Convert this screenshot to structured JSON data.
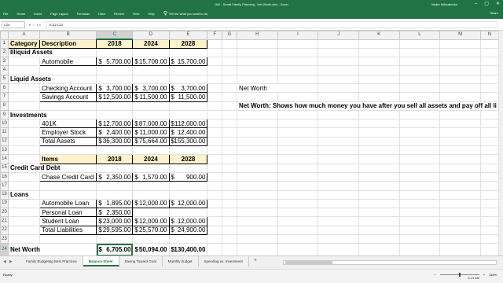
{
  "window": {
    "title": "000 - Smart Family Planning - Net Worth.xlsx - Excel",
    "user": "Vadim Mikhailenko",
    "controls": [
      "–",
      "▢",
      "✕"
    ]
  },
  "ribbon": {
    "tabs": [
      "File",
      "Home",
      "Insert",
      "Page Layout",
      "Formulas",
      "Data",
      "Review",
      "View",
      "Help"
    ],
    "tell_me": "Tell me what you want to do",
    "share": "Share"
  },
  "formula_bar": {
    "name_box": "C24",
    "formula": "=C12-C22"
  },
  "columns": [
    "A",
    "B",
    "C",
    "D",
    "E",
    "F",
    "G",
    "H",
    "I",
    "J",
    "K",
    "L",
    "M",
    "N"
  ],
  "rows": [
    "1",
    "2",
    "3",
    "4",
    "5",
    "6",
    "7",
    "8",
    "9",
    "10",
    "11",
    "12",
    "13",
    "14",
    "15",
    "16",
    "17",
    "18",
    "19",
    "20",
    "21",
    "22",
    "23",
    "24"
  ],
  "sheet": {
    "assets_header": {
      "category": "Category",
      "description": "Description",
      "y1": "2018",
      "y2": "2024",
      "y3": "2028"
    },
    "illiquid": "Illiquid Assets",
    "automobile": {
      "label": "Automobile",
      "v1": "5,700.00",
      "v2": "15,700.00",
      "v3": "15,700.00"
    },
    "liquid": "Liquid Assets",
    "checking": {
      "label": "Checking Account",
      "v1": "3,700.00",
      "v2": "3,700.00",
      "v3": "3,700.00"
    },
    "savings": {
      "label": "Savings Account",
      "v1": "12,500.00",
      "v2": "11,500.00",
      "v3": "11,500.00"
    },
    "investments": "Investments",
    "k401": {
      "label": "401K",
      "v1": "12,700.00",
      "v2": "87,000.00",
      "v3": "112,000.00"
    },
    "employer_stock": {
      "label": "Employer Stock",
      "v1": "2,400.00",
      "v2": "11,000.00",
      "v3": "12,400.00"
    },
    "total_assets": {
      "label": "Total Assets",
      "v1": "36,300.00",
      "v2": "75,664.00",
      "v3": "155,300.00"
    },
    "debt_header": {
      "items": "Items",
      "y1": "2018",
      "y2": "2024",
      "y3": "2028"
    },
    "credit_card_debt": "Credit Card Debt",
    "chase": {
      "label": "Chase Credit Card",
      "v1": "2,350.00",
      "v2": "1,570.00",
      "v3": "900.00"
    },
    "loans": "Loans",
    "auto_loan": {
      "label": "Automobile Loan",
      "v1": "1,895.00",
      "v2": "12,000.00",
      "v3": "12,000.00"
    },
    "personal_loan": {
      "label": "Personal Loan",
      "v1": "2,350.00"
    },
    "student_loan": {
      "label": "Student Loan",
      "v1": "23,000.00",
      "v2": "12,000.00",
      "v3": "12,000.00"
    },
    "total_liabilities": {
      "label": "Total Liabilities",
      "v1": "29,595.00",
      "v2": "25,570.00",
      "v3": "24,900.00"
    },
    "net_worth": {
      "label": "Net Worth",
      "v1": "6,705.00",
      "v2": "50,094.00",
      "v3": "130,400.00"
    },
    "currency": "$",
    "note_title": "Net Worth",
    "note_text": "Net Worth: Shows how much money you have after you sell all assets and pay off all li"
  },
  "sheet_tabs": [
    "Family Budgeting Best Practices",
    "Balance Sheet",
    "Saving Toward Goal",
    "Monthly budget",
    "Spending vs. Investment"
  ],
  "active_tab": "Balance Sheet",
  "add_sheet": "+",
  "status": {
    "ready": "Ready",
    "zoom": "119%",
    "time": "6:13 AM"
  }
}
